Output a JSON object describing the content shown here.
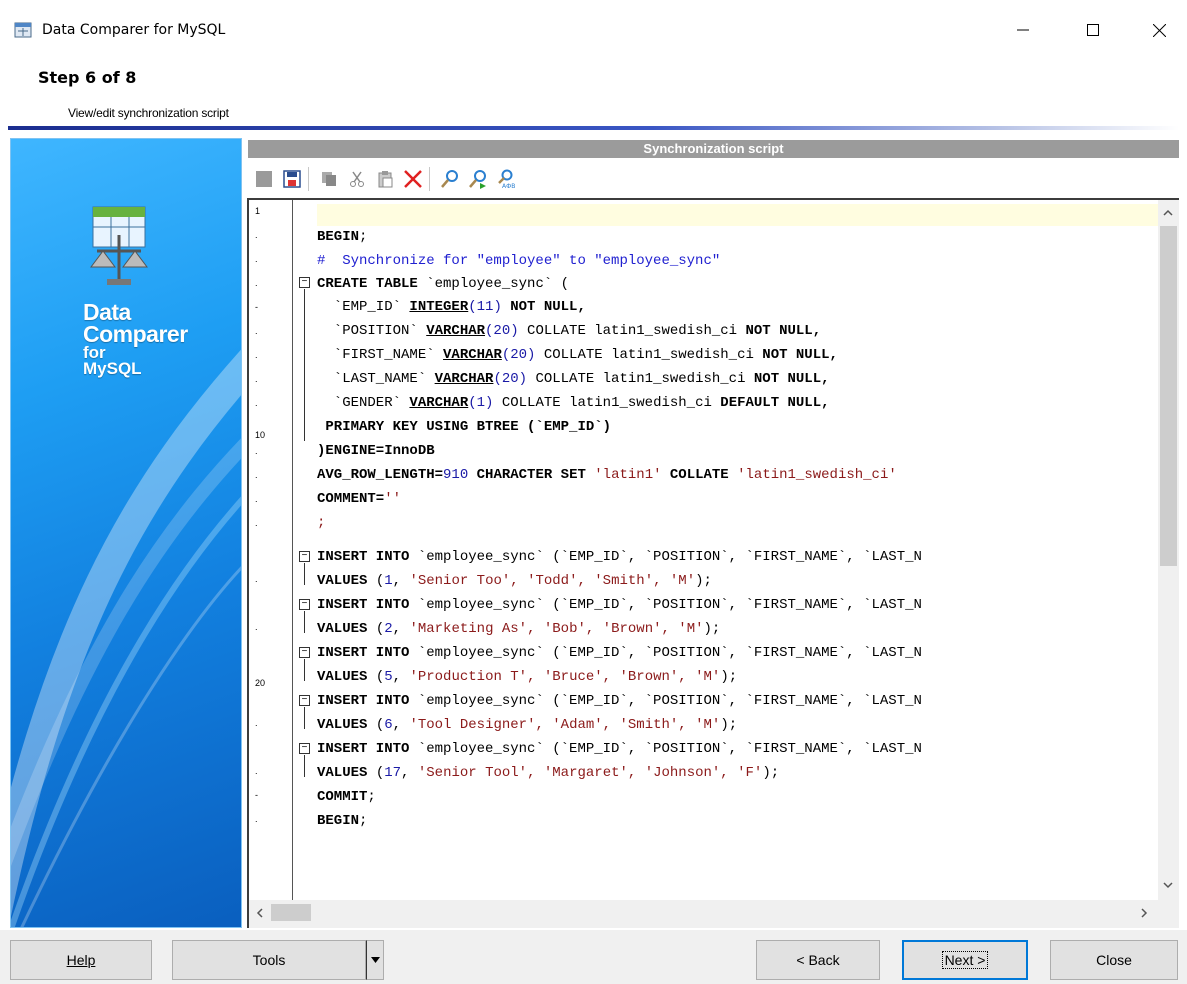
{
  "window": {
    "title": "Data Comparer for MySQL",
    "minimize_glyph": "—",
    "maximize_glyph": "☐",
    "close_glyph": "✕"
  },
  "wizard": {
    "step": "Step 6 of 8",
    "description": "View/edit synchronization script"
  },
  "side_panel": {
    "line1": "Data",
    "line2": "Comparer",
    "line3": "for",
    "line4": "MySQL"
  },
  "panel": {
    "header": "Synchronization script"
  },
  "toolbar": {
    "icons": [
      "save-disabled-icon",
      "save-as-icon",
      "copy-icon",
      "cut-icon",
      "paste-icon",
      "delete-icon",
      "find-icon",
      "find-next-icon",
      "replace-icon"
    ]
  },
  "editor": {
    "line_numbers": {
      "l1": "1",
      "l10": "10",
      "l20": "20",
      "dot": ".",
      "dash": "-"
    },
    "code": {
      "begin1": "BEGIN",
      "semi": ";",
      "comment": "#  Synchronize for \"employee\" to \"employee_sync\"",
      "create_kw": "CREATE TABLE",
      "create_name": " `employee_sync` (",
      "col1_name": "  `EMP_ID` ",
      "col1_type": "INTEGER",
      "col1_len": "(11)",
      "col1_rest": " NOT NULL,",
      "col2_name": "  `POSITION` ",
      "col2_type": "VARCHAR",
      "col2_len": "(20)",
      "col2_rest": " COLLATE latin1_swedish_ci ",
      "col2_null": "NOT NULL,",
      "col3_name": "  `FIRST_NAME` ",
      "col3_type": "VARCHAR",
      "col3_len": "(20)",
      "col3_rest": " COLLATE latin1_swedish_ci ",
      "col3_null": "NOT NULL,",
      "col4_name": "  `LAST_NAME` ",
      "col4_type": "VARCHAR",
      "col4_len": "(20)",
      "col4_rest": " COLLATE latin1_swedish_ci ",
      "col4_null": "NOT NULL,",
      "col5_name": "  `GENDER` ",
      "col5_type": "VARCHAR",
      "col5_len": "(1)",
      "col5_rest": " COLLATE latin1_swedish_ci ",
      "col5_null": "DEFAULT NULL,",
      "pk": " PRIMARY KEY USING BTREE (`EMP_ID`)",
      "engine": ")ENGINE=InnoDB",
      "avg_kw": "AVG_ROW_LENGTH=",
      "avg_num": "910",
      "charset_kw": " CHARACTER SET ",
      "charset_val": "'latin1'",
      "collate_kw": " COLLATE ",
      "collate_val": "'latin1_swedish_ci'",
      "comment_kw": "COMMENT=",
      "comment_val": "''",
      "end_semi": ";",
      "insert": "INSERT INTO",
      "insert_rest": " `employee_sync` (`EMP_ID`, `POSITION`, `FIRST_NAME`, `LAST_N",
      "values_kw": "VALUES",
      "v1_num": "1",
      "v1_rest": "'Senior Too', 'Todd', 'Smith', 'M'",
      "v2_num": "2",
      "v2_rest": "'Marketing As', 'Bob', 'Brown', 'M'",
      "v3_num": "5",
      "v3_rest": "'Production T', 'Bruce', 'Brown', 'M'",
      "v4_num": "6",
      "v4_rest": "'Tool Designer', 'Adam', 'Smith', 'M'",
      "v5_num": "17",
      "v5_rest": "'Senior Tool', 'Margaret', 'Johnson', 'F'",
      "commit": "COMMIT",
      "begin2": "BEGIN"
    }
  },
  "buttons": {
    "help": "Help",
    "tools": "Tools",
    "back": "< Back",
    "next": "Next >",
    "close": "Close"
  },
  "colors": {
    "accent": "#0078d7",
    "string": "#8b1a1a",
    "number": "#1a1aa6",
    "comment": "#2020d0"
  }
}
